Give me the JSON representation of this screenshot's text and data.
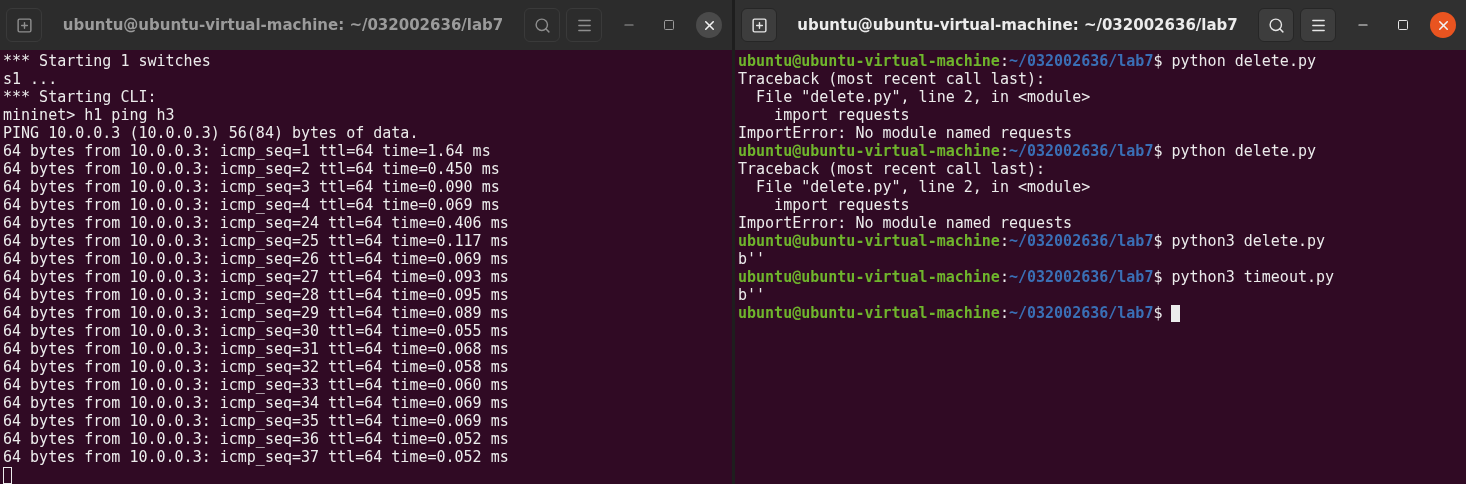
{
  "windows": [
    {
      "title": "ubuntu@ubuntu-virtual-machine: ~/032002636/lab7",
      "focused": false,
      "lines": [
        {
          "kind": "output",
          "text": "*** Starting 1 switches"
        },
        {
          "kind": "output",
          "text": "s1 ..."
        },
        {
          "kind": "output",
          "text": "*** Starting CLI:"
        },
        {
          "kind": "output",
          "text": "mininet> h1 ping h3"
        },
        {
          "kind": "output",
          "text": "PING 10.0.0.3 (10.0.0.3) 56(84) bytes of data."
        },
        {
          "kind": "output",
          "text": "64 bytes from 10.0.0.3: icmp_seq=1 ttl=64 time=1.64 ms"
        },
        {
          "kind": "output",
          "text": "64 bytes from 10.0.0.3: icmp_seq=2 ttl=64 time=0.450 ms"
        },
        {
          "kind": "output",
          "text": "64 bytes from 10.0.0.3: icmp_seq=3 ttl=64 time=0.090 ms"
        },
        {
          "kind": "output",
          "text": "64 bytes from 10.0.0.3: icmp_seq=4 ttl=64 time=0.069 ms"
        },
        {
          "kind": "output",
          "text": "64 bytes from 10.0.0.3: icmp_seq=24 ttl=64 time=0.406 ms"
        },
        {
          "kind": "output",
          "text": "64 bytes from 10.0.0.3: icmp_seq=25 ttl=64 time=0.117 ms"
        },
        {
          "kind": "output",
          "text": "64 bytes from 10.0.0.3: icmp_seq=26 ttl=64 time=0.069 ms"
        },
        {
          "kind": "output",
          "text": "64 bytes from 10.0.0.3: icmp_seq=27 ttl=64 time=0.093 ms"
        },
        {
          "kind": "output",
          "text": "64 bytes from 10.0.0.3: icmp_seq=28 ttl=64 time=0.095 ms"
        },
        {
          "kind": "output",
          "text": "64 bytes from 10.0.0.3: icmp_seq=29 ttl=64 time=0.089 ms"
        },
        {
          "kind": "output",
          "text": "64 bytes from 10.0.0.3: icmp_seq=30 ttl=64 time=0.055 ms"
        },
        {
          "kind": "output",
          "text": "64 bytes from 10.0.0.3: icmp_seq=31 ttl=64 time=0.068 ms"
        },
        {
          "kind": "output",
          "text": "64 bytes from 10.0.0.3: icmp_seq=32 ttl=64 time=0.058 ms"
        },
        {
          "kind": "output",
          "text": "64 bytes from 10.0.0.3: icmp_seq=33 ttl=64 time=0.060 ms"
        },
        {
          "kind": "output",
          "text": "64 bytes from 10.0.0.3: icmp_seq=34 ttl=64 time=0.069 ms"
        },
        {
          "kind": "output",
          "text": "64 bytes from 10.0.0.3: icmp_seq=35 ttl=64 time=0.069 ms"
        },
        {
          "kind": "output",
          "text": "64 bytes from 10.0.0.3: icmp_seq=36 ttl=64 time=0.052 ms"
        },
        {
          "kind": "output",
          "text": "64 bytes from 10.0.0.3: icmp_seq=37 ttl=64 time=0.052 ms"
        },
        {
          "kind": "cursor"
        }
      ]
    },
    {
      "title": "ubuntu@ubuntu-virtual-machine: ~/032002636/lab7",
      "focused": true,
      "lines": [
        {
          "kind": "prompt",
          "user": "ubuntu@ubuntu-virtual-machine",
          "sep": ":",
          "path": "~/032002636/lab7",
          "command": "$ python delete.py"
        },
        {
          "kind": "output",
          "text": "Traceback (most recent call last):"
        },
        {
          "kind": "output",
          "text": "  File \"delete.py\", line 2, in <module>"
        },
        {
          "kind": "output",
          "text": "    import requests"
        },
        {
          "kind": "output",
          "text": "ImportError: No module named requests"
        },
        {
          "kind": "prompt",
          "user": "ubuntu@ubuntu-virtual-machine",
          "sep": ":",
          "path": "~/032002636/lab7",
          "command": "$ python delete.py"
        },
        {
          "kind": "output",
          "text": "Traceback (most recent call last):"
        },
        {
          "kind": "output",
          "text": "  File \"delete.py\", line 2, in <module>"
        },
        {
          "kind": "output",
          "text": "    import requests"
        },
        {
          "kind": "output",
          "text": "ImportError: No module named requests"
        },
        {
          "kind": "prompt",
          "user": "ubuntu@ubuntu-virtual-machine",
          "sep": ":",
          "path": "~/032002636/lab7",
          "command": "$ python3 delete.py"
        },
        {
          "kind": "output",
          "text": "b''"
        },
        {
          "kind": "prompt",
          "user": "ubuntu@ubuntu-virtual-machine",
          "sep": ":",
          "path": "~/032002636/lab7",
          "command": "$ python3 timeout.py"
        },
        {
          "kind": "output",
          "text": "b''"
        },
        {
          "kind": "prompt",
          "user": "ubuntu@ubuntu-virtual-machine",
          "sep": ":",
          "path": "~/032002636/lab7",
          "command": "$",
          "cursor": true
        }
      ]
    }
  ]
}
